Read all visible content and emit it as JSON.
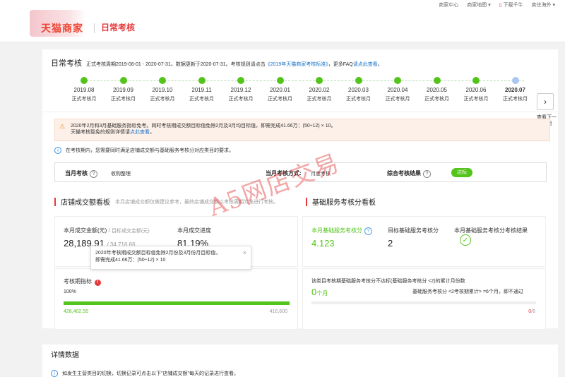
{
  "topbar": {
    "links": [
      "商家中心",
      "商家地图",
      "下载千牛",
      "卖往海外"
    ]
  },
  "header": {
    "brand": "天猫商家",
    "title": "日常考核"
  },
  "overview": {
    "title": "日常考核",
    "desc_prefix": "正式考核周期2019-08-01 - 2020-07-31。数据更新于2020-07-31。考核规则请点击",
    "rule_link": "《2019年天猫商家考核标准》",
    "desc_mid": "，更多FAQ",
    "faq_link": "请点此查看",
    "desc_end": "。"
  },
  "timeline": {
    "months": [
      {
        "label": "2019.08",
        "status": "正式考核月"
      },
      {
        "label": "2019.09",
        "status": "正式考核月"
      },
      {
        "label": "2019.10",
        "status": "正式考核月"
      },
      {
        "label": "2019.11",
        "status": "正式考核月"
      },
      {
        "label": "2019.12",
        "status": "正式考核月"
      },
      {
        "label": "2020.01",
        "status": "正式考核月"
      },
      {
        "label": "2020.02",
        "status": "正式考核月"
      },
      {
        "label": "2020.03",
        "status": "正式考核月"
      },
      {
        "label": "2020.04",
        "status": "正式考核月"
      },
      {
        "label": "2020.05",
        "status": "正式考核月"
      },
      {
        "label": "2020.06",
        "status": "正式考核月"
      },
      {
        "label": "2020.07",
        "status": "正式考核月"
      }
    ],
    "next_label": "查看下一周期"
  },
  "warning": {
    "line1": "2020年2月和3月基础服务指标免考。同时考核期成交额目标值免除2月及3月均目标值，即需完成41.66万：(50÷12) × 10。",
    "line2_prefix": "天猫考核豁免的规则详情请",
    "line2_link": "点此查看",
    "line2_end": "。"
  },
  "info": {
    "text": "在考核期内，您需要同时满足店铺成交额与基础服务考核分对应类目的要求。"
  },
  "metrics": {
    "month_assess_label": "当月考核",
    "month_assess_value": "收购整理",
    "method_label": "当月考核方式:",
    "method_value": "月度考核",
    "result_label": "综合考核结果",
    "result_value": "达标"
  },
  "left_section": {
    "title": "店铺成交额看板",
    "desc": "本月店铺成交额仅做建议参考，最终店铺成交额以考核周期为准进行考核。"
  },
  "right_section": {
    "title": "基础服务考核分看板"
  },
  "sales": {
    "amount_label": "本月成交金额(元)",
    "target_label": "目标成交金额(元)",
    "amount_value": "28,189.91",
    "target_value": "34,716.66",
    "progress_label": "本月成交进度",
    "progress_value": "81.19%"
  },
  "tooltip": {
    "line1": "2020年考核期成交额目标值免除2月份及3月份月目标值，",
    "line2": "即需完成41.66万：(50÷12) × 10",
    "close": "×"
  },
  "period_metric": {
    "label": "考核期指标",
    "percent": "100%",
    "fill_fraction": 1.0,
    "current": "428,402.55",
    "target": "416,600"
  },
  "service": {
    "score_label": "本月基础服务考核分",
    "score_value": "4.123",
    "target_label": "目标基础服务考核分",
    "target_value": "2",
    "result_label": "本月基础服务考核分考核结果",
    "below_desc": "该类目考核期基础服务考核分不达标(基础服务考核分 <2)的累计月份数",
    "months_value": "0",
    "months_unit": "个月",
    "rule_text": "基础服务考核分 <2考核期累计> =6个月，即不通过",
    "counter_value": "0",
    "counter_total": "/6"
  },
  "details": {
    "title": "详情数据",
    "info": "如发生主营类目的切换，切换记录可点击以下\"店铺成交额\"每天的记录进行查看。"
  },
  "watermark": {
    "text": "A5网店交易"
  }
}
